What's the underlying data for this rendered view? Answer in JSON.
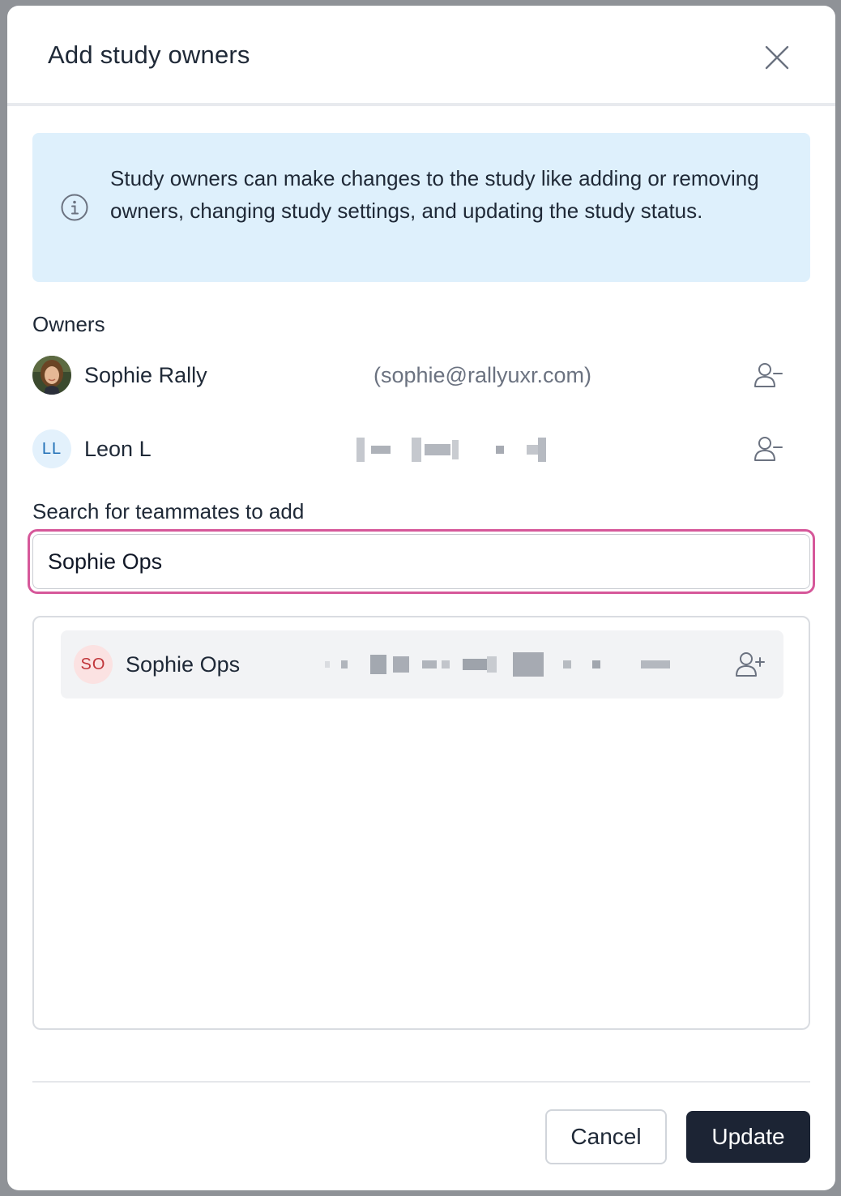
{
  "modal": {
    "title": "Add study owners"
  },
  "info": {
    "text": "Study owners can make changes to the study like adding or removing owners, changing study settings, and updating the study status."
  },
  "owners": {
    "label": "Owners",
    "items": [
      {
        "name": "Sophie Rally",
        "email": "(sophie@rallyuxr.com)",
        "avatar": "photo",
        "action_icon": "user-minus-icon"
      },
      {
        "name": "Leon L",
        "initials": "LL",
        "email_redacted": true,
        "action_icon": "user-minus-icon"
      }
    ]
  },
  "search": {
    "label": "Search for teammates to add",
    "value": "Sophie Ops"
  },
  "results": [
    {
      "name": "Sophie Ops",
      "initials": "SO",
      "email_redacted": true,
      "action_icon": "user-plus-icon"
    }
  ],
  "footer": {
    "cancel_label": "Cancel",
    "update_label": "Update"
  },
  "colors": {
    "focus_ring": "#d6589a",
    "info_bg": "#def0fc",
    "primary_button": "#1c2434",
    "ll_avatar_bg": "#e3f1fc",
    "ll_avatar_text": "#1f6fb6",
    "so_avatar_bg": "#fbe2e2",
    "so_avatar_text": "#c0353a"
  }
}
